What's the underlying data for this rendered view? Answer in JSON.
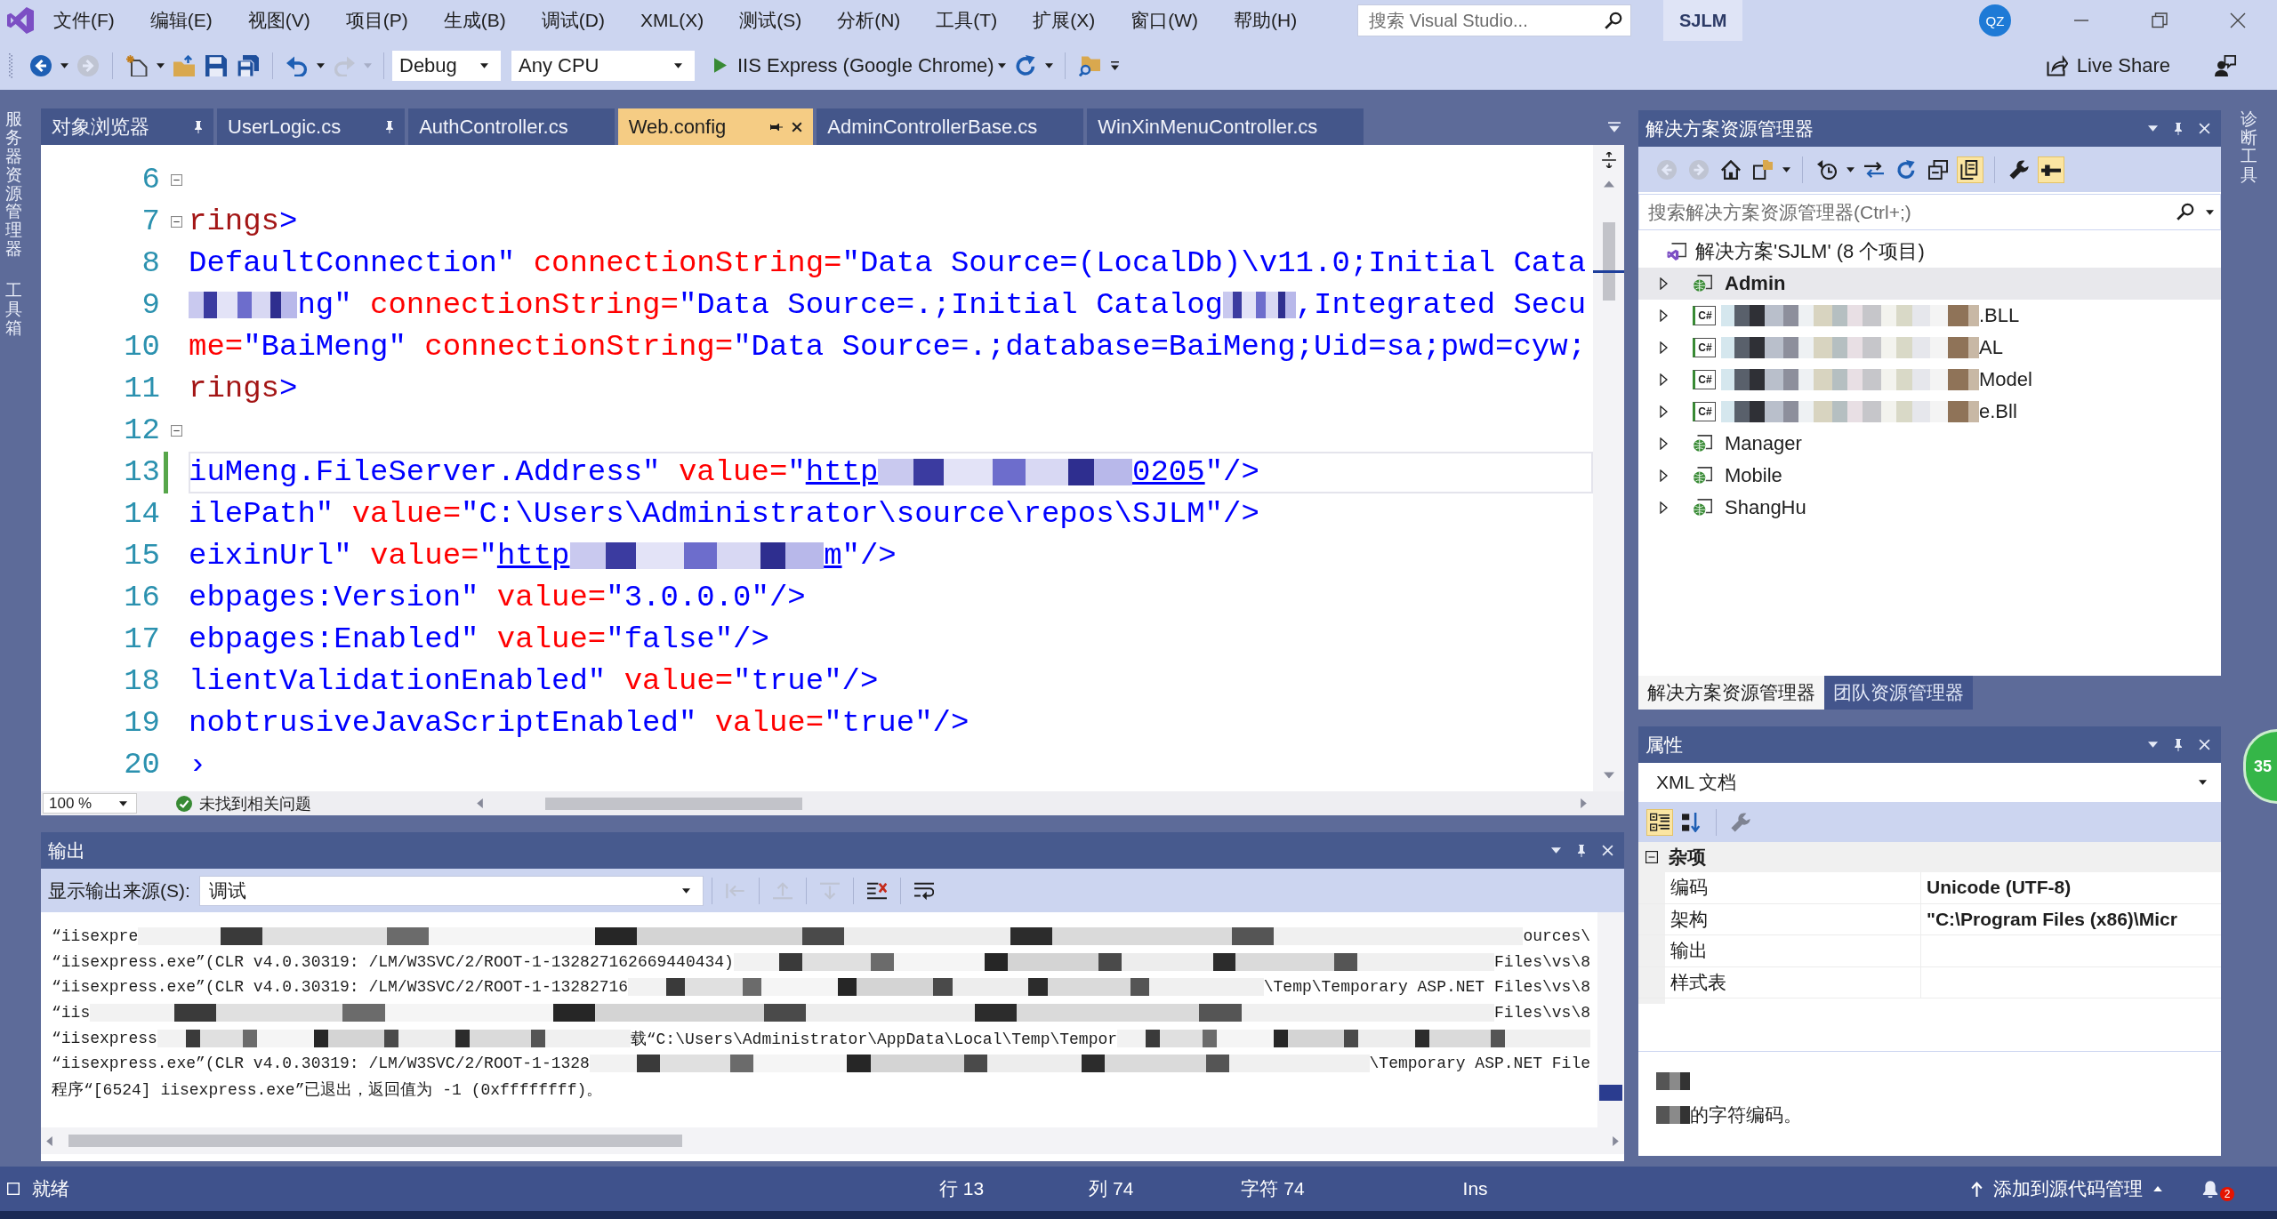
{
  "title_bar": {
    "menu": [
      "文件(F)",
      "编辑(E)",
      "视图(V)",
      "项目(P)",
      "生成(B)",
      "调试(D)",
      "XML(X)",
      "测试(S)",
      "分析(N)",
      "工具(T)",
      "扩展(X)",
      "窗口(W)",
      "帮助(H)"
    ],
    "search": {
      "placeholder": "搜索 Visual Studio..."
    },
    "solution": "SJLM",
    "account": "QZ"
  },
  "toolbar": {
    "buttons": [
      {
        "kind": "back",
        "disabled": false
      },
      {
        "kind": "forward",
        "disabled": true
      },
      {
        "kind": "new",
        "disabled": false
      },
      {
        "kind": "open",
        "disabled": false
      },
      {
        "kind": "save",
        "disabled": false
      },
      {
        "kind": "saveall",
        "disabled": false
      },
      {
        "kind": "undo",
        "disabled": false
      },
      {
        "kind": "redo",
        "disabled": true
      }
    ],
    "configuration": "Debug",
    "platform": "Any CPU",
    "run_target": "IIS Express (Google Chrome)",
    "live_share": "Live Share"
  },
  "left_strip": [
    "服务器资源管理器",
    "工具箱"
  ],
  "document_tabs": [
    {
      "label": "对象浏览器",
      "pinned": true,
      "selected": false
    },
    {
      "label": "UserLogic.cs",
      "pinned": true,
      "selected": false
    },
    {
      "label": "AuthController.cs",
      "pinned": false,
      "selected": false
    },
    {
      "label": "Web.config",
      "pinned": false,
      "selected": true
    },
    {
      "label": "AdminControllerBase.cs",
      "pinned": false,
      "selected": false
    },
    {
      "label": "WinXinMenuController.cs",
      "pinned": false,
      "selected": false
    }
  ],
  "editor": {
    "lines": [
      {
        "number": "6",
        "foldable": true,
        "changed": false,
        "current": false
      },
      {
        "number": "7",
        "foldable": true,
        "changed": false,
        "current": false,
        "tokens": [
          {
            "kind": "element",
            "text": "rings"
          },
          {
            "kind": "delim",
            "text": ">"
          }
        ]
      },
      {
        "number": "8",
        "foldable": false,
        "changed": false,
        "current": false,
        "tokens": [
          {
            "kind": "value",
            "text": "DefaultConnection\""
          },
          {
            "kind": "attr",
            "text": " connectionString="
          },
          {
            "kind": "value",
            "text": "\"Data Source=(LocalDb)\\v11.0;Initial Cata"
          }
        ]
      },
      {
        "number": "9",
        "foldable": false,
        "changed": false,
        "current": false,
        "tokens": [
          {
            "kind": "blur_m"
          },
          {
            "kind": "value",
            "text": "ng\""
          },
          {
            "kind": "attr",
            "text": " connectionString="
          },
          {
            "kind": "value",
            "text": "\"Data Source=.;Initial Catalog"
          },
          {
            "kind": "blur_s"
          },
          {
            "kind": "value",
            "text": ",Integrated Secu"
          }
        ]
      },
      {
        "number": "10",
        "foldable": false,
        "changed": false,
        "current": false,
        "tokens": [
          {
            "kind": "attr",
            "text": "me="
          },
          {
            "kind": "value",
            "text": "\"BaiMeng\""
          },
          {
            "kind": "attr",
            "text": " connectionString="
          },
          {
            "kind": "value",
            "text": "\"Data Source=.;database=BaiMeng;Uid=sa;pwd=cyw;"
          }
        ]
      },
      {
        "number": "11",
        "foldable": false,
        "changed": false,
        "current": false,
        "tokens": [
          {
            "kind": "element",
            "text": "rings"
          },
          {
            "kind": "delim",
            "text": ">"
          }
        ]
      },
      {
        "number": "12",
        "foldable": true,
        "changed": false,
        "current": false
      },
      {
        "number": "13",
        "foldable": false,
        "changed": true,
        "current": true,
        "tokens": [
          {
            "kind": "value",
            "text": "iuMeng.FileServer.Address\""
          },
          {
            "kind": "attr",
            "text": " value="
          },
          {
            "kind": "value",
            "text": "\""
          },
          {
            "kind": "link",
            "text": "http"
          },
          {
            "kind": "blur_l"
          },
          {
            "kind": "link",
            "text": "0205"
          },
          {
            "kind": "value",
            "text": "\""
          },
          {
            "kind": "delim",
            "text": "/>"
          }
        ]
      },
      {
        "number": "14",
        "foldable": false,
        "changed": false,
        "current": false,
        "tokens": [
          {
            "kind": "value",
            "text": "ilePath\""
          },
          {
            "kind": "attr",
            "text": " value="
          },
          {
            "kind": "value",
            "text": "\"C:\\Users\\Administrator\\source\\repos\\SJLM\""
          },
          {
            "kind": "delim",
            "text": "/>"
          }
        ]
      },
      {
        "number": "15",
        "foldable": false,
        "changed": false,
        "current": false,
        "tokens": [
          {
            "kind": "value",
            "text": "eixinUrl\""
          },
          {
            "kind": "attr",
            "text": " value="
          },
          {
            "kind": "value",
            "text": "\""
          },
          {
            "kind": "link",
            "text": "http"
          },
          {
            "kind": "blur_l"
          },
          {
            "kind": "link",
            "text": "m"
          },
          {
            "kind": "value",
            "text": "\""
          },
          {
            "kind": "delim",
            "text": "/>"
          }
        ]
      },
      {
        "number": "16",
        "foldable": false,
        "changed": false,
        "current": false,
        "tokens": [
          {
            "kind": "value",
            "text": "ebpages:Version\""
          },
          {
            "kind": "attr",
            "text": " value="
          },
          {
            "kind": "value",
            "text": "\"3.0.0.0\""
          },
          {
            "kind": "delim",
            "text": "/>"
          }
        ]
      },
      {
        "number": "17",
        "foldable": false,
        "changed": false,
        "current": false,
        "tokens": [
          {
            "kind": "value",
            "text": "ebpages:Enabled\""
          },
          {
            "kind": "attr",
            "text": " value="
          },
          {
            "kind": "value",
            "text": "\"false\""
          },
          {
            "kind": "delim",
            "text": "/>"
          }
        ]
      },
      {
        "number": "18",
        "foldable": false,
        "changed": false,
        "current": false,
        "tokens": [
          {
            "kind": "value",
            "text": "lientValidationEnabled\""
          },
          {
            "kind": "attr",
            "text": " value="
          },
          {
            "kind": "value",
            "text": "\"true\""
          },
          {
            "kind": "delim",
            "text": "/>"
          }
        ]
      },
      {
        "number": "19",
        "foldable": false,
        "changed": false,
        "current": false,
        "tokens": [
          {
            "kind": "value",
            "text": "nobtrusiveJavaScriptEnabled\""
          },
          {
            "kind": "attr",
            "text": " value="
          },
          {
            "kind": "value",
            "text": "\"true\""
          },
          {
            "kind": "delim",
            "text": "/>"
          }
        ]
      },
      {
        "number": "20",
        "foldable": false,
        "changed": false,
        "current": false,
        "tokens": [
          {
            "kind": "delim",
            "text": "›"
          }
        ]
      }
    ],
    "zoom": "100 %",
    "issues": "未找到相关问题"
  },
  "output": {
    "title": "输出",
    "source_label": "显示输出来源(S):",
    "source": "调试",
    "toolbar": [
      {
        "kind": "back",
        "disabled": true
      },
      {
        "kind": "prev",
        "disabled": true
      },
      {
        "kind": "next",
        "disabled": true
      },
      {
        "kind": "clear",
        "disabled": false
      },
      {
        "kind": "wrap",
        "disabled": false
      }
    ],
    "lines": [
      {
        "segments": [
          {
            "kind": "text",
            "text": "“iisexpre"
          },
          {
            "kind": "blur"
          },
          {
            "kind": "text",
            "text": "ources\\"
          }
        ]
      },
      {
        "segments": [
          {
            "kind": "text",
            "text": "“iisexpress.exe”(CLR v4.0.30319: /LM/W3SVC/2/ROOT-1-132827162669440434)"
          },
          {
            "kind": "blur"
          },
          {
            "kind": "text",
            "text": "Files\\vs\\8"
          }
        ]
      },
      {
        "segments": [
          {
            "kind": "text",
            "text": "“iisexpress.exe”(CLR v4.0.30319: /LM/W3SVC/2/ROOT-1-13282716"
          },
          {
            "kind": "blur"
          },
          {
            "kind": "text",
            "text": "\\Temp\\Temporary ASP.NET Files\\vs\\8"
          }
        ]
      },
      {
        "segments": [
          {
            "kind": "text",
            "text": "“iis"
          },
          {
            "kind": "blur"
          },
          {
            "kind": "text",
            "text": "Files\\vs\\8"
          }
        ]
      },
      {
        "segments": [
          {
            "kind": "text",
            "text": "“iisexpress"
          },
          {
            "kind": "blur"
          },
          {
            "kind": "text",
            "text": "载“C:\\Users\\Administrator\\AppData\\Local\\Temp\\Tempor"
          },
          {
            "kind": "blur"
          }
        ]
      },
      {
        "segments": [
          {
            "kind": "text",
            "text": "“iisexpress.exe”(CLR v4.0.30319: /LM/W3SVC/2/ROOT-1-1328"
          },
          {
            "kind": "blur"
          },
          {
            "kind": "text",
            "text": "\\Temporary ASP.NET File"
          }
        ]
      },
      {
        "segments": [
          {
            "kind": "text",
            "text": "程序“[6524] iisexpress.exe”已退出，返回值为 -1 (0xffffffff)。"
          }
        ]
      }
    ]
  },
  "solution_explorer": {
    "title": "解决方案资源管理器",
    "toolbar": [
      {
        "kind": "back",
        "selected": false,
        "disabled": true
      },
      {
        "kind": "forward",
        "selected": false,
        "disabled": true
      },
      {
        "kind": "home",
        "selected": false,
        "disabled": false
      },
      {
        "kind": "views",
        "selected": false,
        "disabled": false
      },
      {
        "kind": "pending",
        "selected": false,
        "disabled": false
      },
      {
        "kind": "sync",
        "selected": false,
        "disabled": false
      },
      {
        "kind": "refresh",
        "selected": false,
        "disabled": false
      },
      {
        "kind": "collapse",
        "selected": false,
        "disabled": false
      },
      {
        "kind": "showall",
        "selected": true,
        "disabled": false
      },
      {
        "kind": "properties",
        "selected": false,
        "disabled": false
      },
      {
        "kind": "preview",
        "selected": true,
        "disabled": false
      }
    ],
    "search": {
      "placeholder": "搜索解决方案资源管理器(Ctrl+;)"
    },
    "tree": {
      "label": "解决方案'SJLM' (8 个项目)",
      "children": [
        {
          "label": "Admin",
          "kind": "web",
          "blurred": false,
          "startup": true,
          "selected": true,
          "expanded": false
        },
        {
          "label": ".BLL",
          "kind": "csharp",
          "badge": "C#",
          "blurred": true,
          "startup": false,
          "selected": false,
          "expanded": false
        },
        {
          "label": "AL",
          "kind": "csharp",
          "badge": "C#",
          "blurred": true,
          "startup": false,
          "selected": false,
          "expanded": false
        },
        {
          "label": "Model",
          "kind": "csharp",
          "badge": "C#",
          "blurred": true,
          "startup": false,
          "selected": false,
          "expanded": false
        },
        {
          "label": "e.Bll",
          "kind": "csharp",
          "badge": "C#",
          "blurred": true,
          "startup": false,
          "selected": false,
          "expanded": false
        },
        {
          "label": "Manager",
          "kind": "web",
          "blurred": false,
          "startup": false,
          "selected": false,
          "expanded": false
        },
        {
          "label": "Mobile",
          "kind": "web",
          "blurred": false,
          "startup": false,
          "selected": false,
          "expanded": false
        },
        {
          "label": "ShangHu",
          "kind": "web",
          "blurred": false,
          "startup": false,
          "selected": false,
          "expanded": false
        }
      ]
    },
    "tabs": [
      {
        "label": "解决方案资源管理器",
        "selected": true
      },
      {
        "label": "团队资源管理器",
        "selected": false
      }
    ]
  },
  "properties": {
    "title": "属性",
    "object": "XML 文档",
    "toolbar": [
      {
        "kind": "categorized",
        "selected": true,
        "disabled": false
      },
      {
        "kind": "alphabetical",
        "selected": false,
        "disabled": false
      },
      {
        "kind": "pages",
        "selected": false,
        "disabled": true
      }
    ],
    "category": {
      "label": "杂项",
      "expanded": true,
      "rows": [
        {
          "name": "编码",
          "value": "Unicode (UTF-8)"
        },
        {
          "name": "架构",
          "value": "\"C:\\Program Files (x86)\\Micr"
        },
        {
          "name": "输出"
        },
        {
          "name": "样式表"
        }
      ]
    },
    "description": [
      {
        "segments": [
          {
            "kind": "blur"
          }
        ]
      },
      {
        "segments": [
          {
            "kind": "blur"
          },
          {
            "kind": "text",
            "text": "的字符编码。"
          }
        ]
      }
    ]
  },
  "right_strip": [
    "诊断工具"
  ],
  "floating_badge": "35",
  "status_bar": {
    "state": "就绪",
    "line": "行 13",
    "column": "列 74",
    "character": "字符 74",
    "mode": "Ins",
    "source_control": "添加到源代码管理",
    "notifications": "2"
  }
}
